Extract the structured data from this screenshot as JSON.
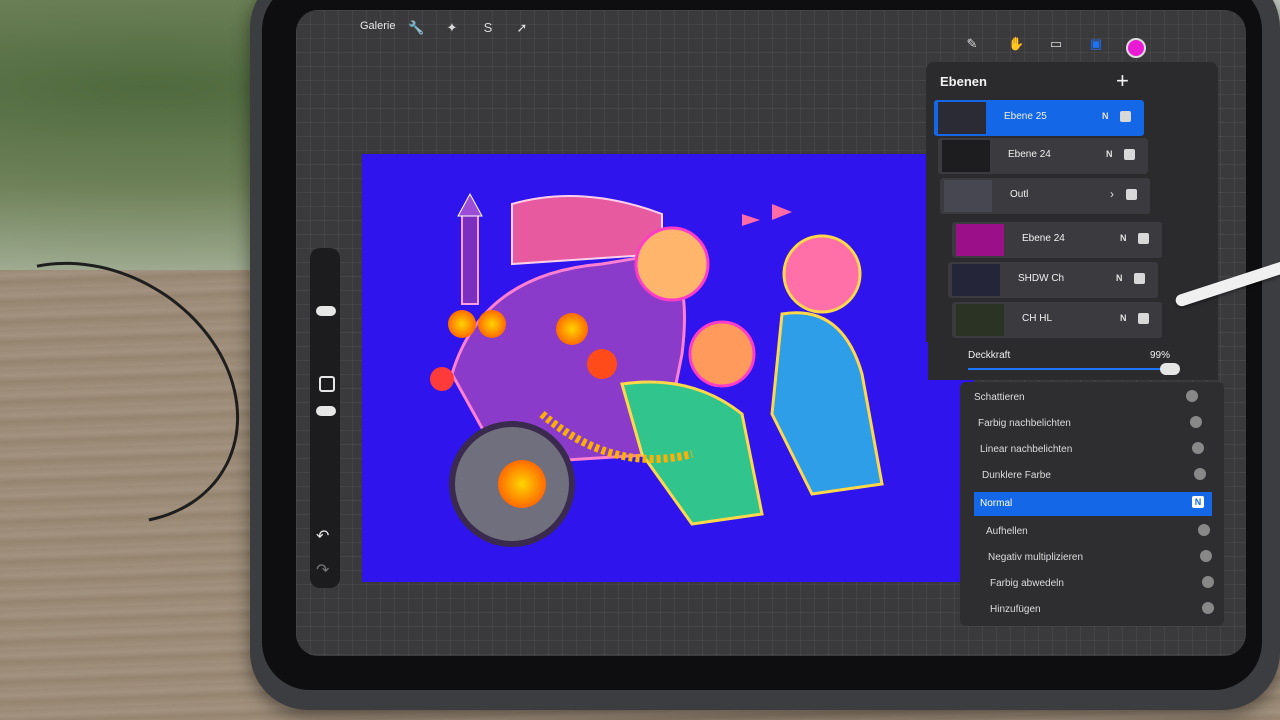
{
  "toolbar": {
    "gallery_label": "Galerie",
    "tools": [
      "wrench-icon",
      "wand-icon",
      "selection-icon",
      "transform-icon"
    ],
    "right_tools": [
      "brush-icon",
      "smudge-icon",
      "eraser-icon",
      "layers-icon"
    ],
    "current_color": "#e91ad4"
  },
  "layers": {
    "title": "Ebenen",
    "add_symbol": "+",
    "items": [
      {
        "name": "Ebene 25",
        "blend": "N",
        "visible": true,
        "active": true
      },
      {
        "name": "Ebene 24",
        "blend": "N",
        "visible": true,
        "active": false
      },
      {
        "name": "Outl",
        "blend": "",
        "group": true,
        "visible": true,
        "active": false
      },
      {
        "name": "Ebene 24",
        "blend": "N",
        "visible": true,
        "active": false
      },
      {
        "name": "SHDW Ch",
        "blend": "N",
        "visible": true,
        "active": false
      },
      {
        "name": "CH HL",
        "blend": "N",
        "visible": true,
        "active": false
      }
    ]
  },
  "opacity": {
    "label": "Deckkraft",
    "value_text": "99%",
    "value": 0.99
  },
  "blend_modes": [
    {
      "label": "Schattieren",
      "selected": false
    },
    {
      "label": "Farbig nachbelichten",
      "selected": false
    },
    {
      "label": "Linear nachbelichten",
      "selected": false
    },
    {
      "label": "Dunklere Farbe",
      "selected": false
    },
    {
      "label": "Normal",
      "selected": true,
      "badge": "N"
    },
    {
      "label": "Aufhellen",
      "selected": false
    },
    {
      "label": "Negativ multiplizieren",
      "selected": false
    },
    {
      "label": "Farbig abwedeln",
      "selected": false
    },
    {
      "label": "Hinzufügen",
      "selected": false
    }
  ],
  "canvas": {
    "background_color": "#2f14ee"
  }
}
